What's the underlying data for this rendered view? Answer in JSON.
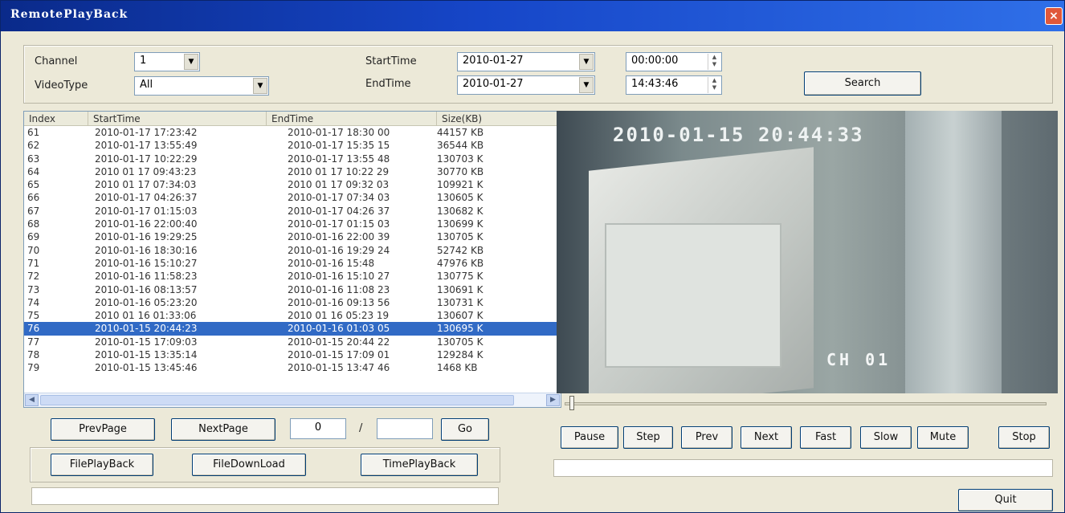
{
  "window": {
    "title": "RemotePlayBack",
    "close_label": "×"
  },
  "query": {
    "channel_label": "Channel",
    "channel_value": "1",
    "videotype_label": "VideoType",
    "videotype_value": "All",
    "starttime_label": "StartTime",
    "start_date": "2010-01-27",
    "start_time": "00:00:00",
    "endtime_label": "EndTime",
    "end_date": "2010-01-27",
    "end_time": "14:43:46",
    "search_label": "Search"
  },
  "list": {
    "columns": [
      "Index",
      "StartTime",
      "EndTime",
      "Size(KB)"
    ],
    "rows": [
      [
        "61",
        "2010-01-17 17:23:42",
        "2010-01-17 18:30 00",
        "44157 KB"
      ],
      [
        "62",
        "2010-01-17 13:55:49",
        "2010-01-17 15:35 15",
        "36544 KB"
      ],
      [
        "63",
        "2010-01-17 10:22:29",
        "2010-01-17 13:55 48",
        "130703 K"
      ],
      [
        "64",
        "2010 01 17 09:43:23",
        "2010 01 17 10:22 29",
        "30770 KB"
      ],
      [
        "65",
        "2010 01 17 07:34:03",
        "2010 01 17 09:32 03",
        "109921 K"
      ],
      [
        "66",
        "2010-01-17 04:26:37",
        "2010-01-17 07:34 03",
        "130605 K"
      ],
      [
        "67",
        "2010-01-17 01:15:03",
        "2010-01-17 04:26 37",
        "130682 K"
      ],
      [
        "68",
        "2010-01-16 22:00:40",
        "2010-01-17 01:15 03",
        "130699 K"
      ],
      [
        "69",
        "2010-01-16 19:29:25",
        "2010-01-16 22:00 39",
        "130705 K"
      ],
      [
        "70",
        "2010-01-16 18:30:16",
        "2010-01-16 19:29 24",
        "52742 KB"
      ],
      [
        "71",
        "2010-01-16 15:10:27",
        "2010-01-16 15:48",
        "47976 KB"
      ],
      [
        "72",
        "2010-01-16 11:58:23",
        "2010-01-16 15:10 27",
        "130775 K"
      ],
      [
        "73",
        "2010-01-16 08:13:57",
        "2010-01-16 11:08 23",
        "130691 K"
      ],
      [
        "74",
        "2010-01-16 05:23:20",
        "2010-01-16 09:13 56",
        "130731 K"
      ],
      [
        "75",
        "2010 01 16 01:33:06",
        "2010 01 16 05:23 19",
        "130607 K"
      ],
      [
        "76",
        "2010-01-15 20:44:23",
        "2010-01-16 01:03 05",
        "130695 K"
      ],
      [
        "77",
        "2010-01-15 17:09:03",
        "2010-01-15 20:44 22",
        "130705 K"
      ],
      [
        "78",
        "2010-01-15 13:35:14",
        "2010-01-15 17:09 01",
        "129284 K"
      ],
      [
        "79",
        "2010-01-15 13:45:46",
        "2010-01-15 13:47 46",
        "1468 KB"
      ]
    ],
    "selected_index": 15
  },
  "paging": {
    "prev_label": "PrevPage",
    "next_label": "NextPage",
    "current_page": "0",
    "separator": "/",
    "total_pages": "",
    "go_label": "Go"
  },
  "actions": {
    "file_playback": "FilePlayBack",
    "file_download": "FileDownLoad",
    "time_playback": "TimePlayBack"
  },
  "video": {
    "timestamp": "2010-01-15 20:44:33",
    "channel_overlay": "CH 01"
  },
  "controls": {
    "pause": "Pause",
    "step": "Step",
    "prev": "Prev",
    "next": "Next",
    "fast": "Fast",
    "slow": "Slow",
    "mute": "Mute",
    "stop": "Stop",
    "quit": "Quit"
  }
}
